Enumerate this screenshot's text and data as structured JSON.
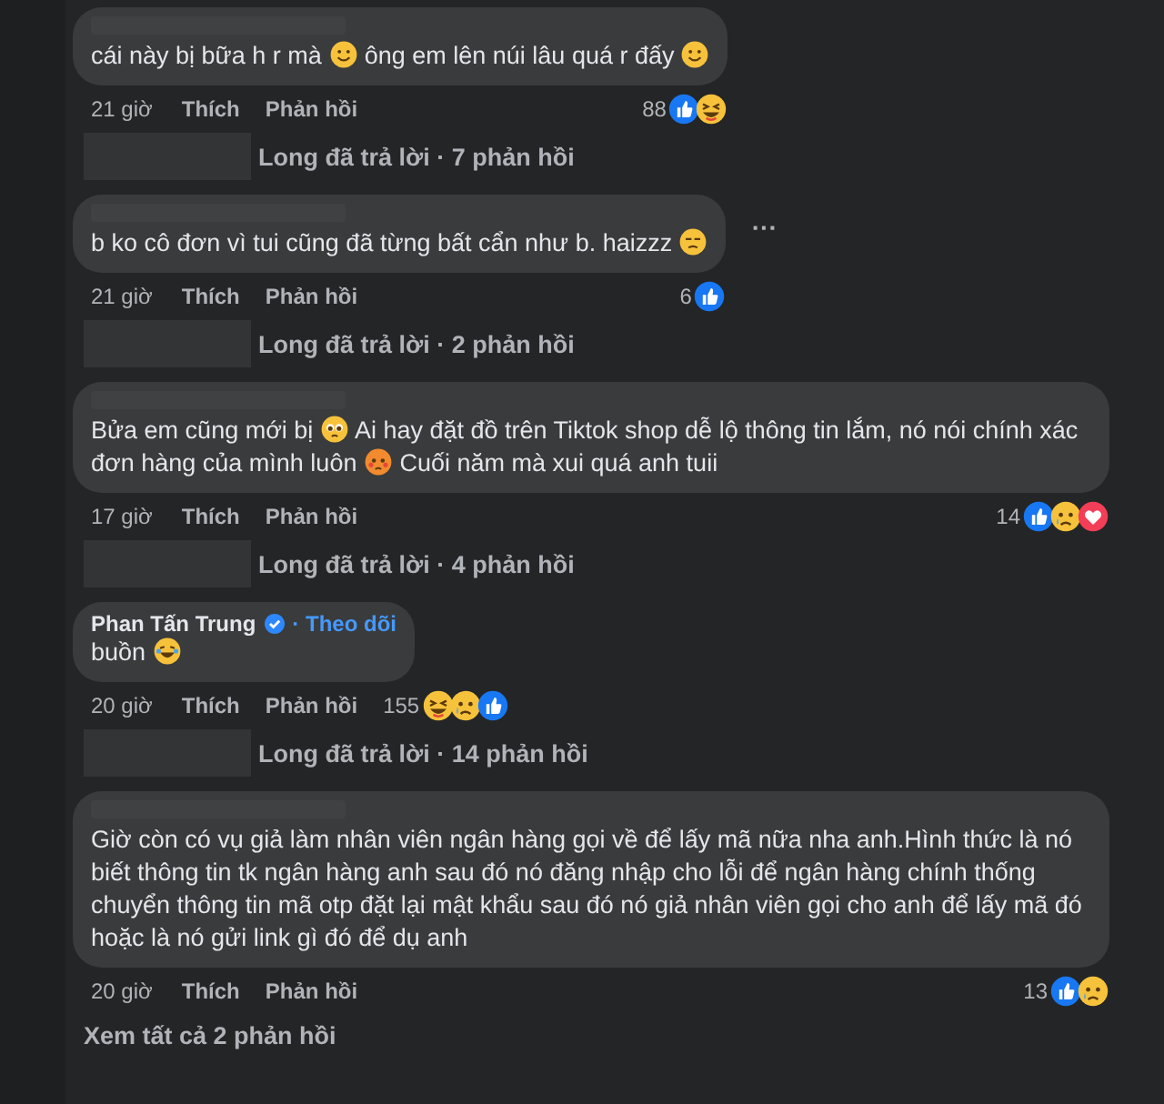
{
  "comments": [
    {
      "text": [
        {
          "kind": "text",
          "text": "cái này bị bữa h r mà "
        },
        {
          "kind": "smile"
        },
        {
          "kind": "text",
          "text": " ông em lên núi lâu quá r đấy "
        },
        {
          "kind": "smile"
        }
      ],
      "time": "21 giờ",
      "like": "Thích",
      "reply": "Phản hồi",
      "reaction_count": "88",
      "reactions": [
        {
          "kind": "like"
        },
        {
          "kind": "laugh"
        }
      ],
      "replies": "Long đã trả lời · 7 phản hồi"
    },
    {
      "menu": "···",
      "text": [
        {
          "kind": "text",
          "text": "b ko cô đơn vì tui cũng đã từng bất cẩn như b. haizzz "
        },
        {
          "kind": "unamused"
        }
      ],
      "time": "21 giờ",
      "like": "Thích",
      "reply": "Phản hồi",
      "reaction_count": "6",
      "reactions": [
        {
          "kind": "like"
        }
      ],
      "replies": "Long đã trả lời · 2 phản hồi"
    },
    {
      "text": [
        {
          "kind": "text",
          "text": "Bửa em cũng mới bị "
        },
        {
          "kind": "pleading"
        },
        {
          "kind": "text",
          "text": " Ai hay đặt đồ trên Tiktok shop dễ lộ thông tin lắm, nó nói chính xác đơn hàng của mình luôn "
        },
        {
          "kind": "flushed"
        },
        {
          "kind": "text",
          "text": " Cuối năm mà xui quá anh tuii"
        }
      ],
      "time": "17 giờ",
      "like": "Thích",
      "reply": "Phản hồi",
      "reaction_count": "14",
      "reactions": [
        {
          "kind": "like"
        },
        {
          "kind": "sad"
        },
        {
          "kind": "love"
        }
      ],
      "replies": "Long đã trả lời · 4 phản hồi"
    },
    {
      "author": "Phan Tấn Trung",
      "verified": true,
      "follow": "· Theo dõi",
      "text": [
        {
          "kind": "text",
          "text": "buồn "
        },
        {
          "kind": "tears"
        }
      ],
      "time": "20 giờ",
      "like": "Thích",
      "reply": "Phản hồi",
      "reaction_count": "155",
      "reactions": [
        {
          "kind": "laugh"
        },
        {
          "kind": "sad"
        },
        {
          "kind": "like"
        }
      ],
      "replies": "Long đã trả lời · 14 phản hồi"
    },
    {
      "text": [
        {
          "kind": "text",
          "text": "Giờ còn có vụ giả làm nhân viên ngân hàng gọi về để lấy mã nữa nha anh.Hình thức là nó biết thông tin tk ngân hàng anh sau đó nó đăng nhập cho lỗi để ngân hàng chính thống chuyển thông tin mã otp đặt lại mật khẩu sau đó nó giả nhân viên gọi cho anh để lấy mã đó hoặc là nó gửi link gì đó để dụ anh"
        }
      ],
      "time": "20 giờ",
      "like": "Thích",
      "reply": "Phản hồi",
      "reaction_count": "13",
      "reactions": [
        {
          "kind": "like"
        },
        {
          "kind": "sad"
        }
      ]
    }
  ],
  "view_all": "Xem tất cả 2 phản hồi"
}
